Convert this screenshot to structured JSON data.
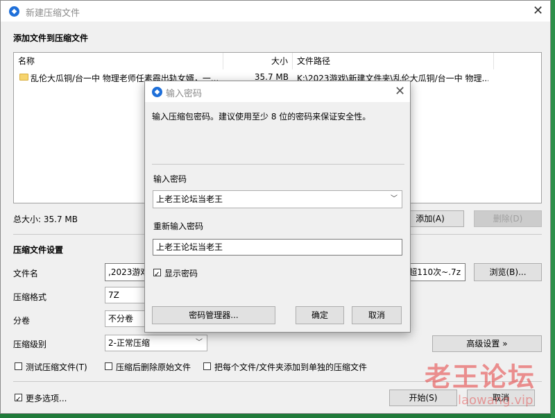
{
  "window": {
    "title": "新建压缩文件",
    "section_add": "添加文件到压缩文件",
    "columns": [
      "名称",
      "大小",
      "文件路径"
    ],
    "files": [
      {
        "name": "乱伦大瓜铜/台一中 物理老师任素霞出轨女婿，一...",
        "size": "35.7 MB",
        "path": "K:\\2023游戏\\新建文件夹\\乱伦大瓜铜/台一中 物理..."
      }
    ],
    "total_size": "总大小: 35.7 MB",
    "add_button": "添加(A)",
    "delete_button": "删除(D)",
    "settings_title": "压缩文件设置",
    "filename_label": "文件名",
    "filename_value": ",2023游戏\\",
    "filename_tail": "超110次~.7z",
    "browse_button": "浏览(B)...",
    "format_label": "压缩格式",
    "format_value": "7Z",
    "split_label": "分卷",
    "split_value": "不分卷",
    "level_label": "压缩级别",
    "level_value": "2-正常压缩",
    "advanced_button": "高级设置 »",
    "test_checkbox": "测试压缩文件(T)",
    "delete_after_checkbox": "压缩后删除原始文件",
    "separate_checkbox": "把每个文件/文件夹添加到单独的压缩文件",
    "more_options": "更多选项...",
    "start_button": "开始(S)",
    "cancel_button": "取消"
  },
  "dialog": {
    "title": "输入密码",
    "message": "输入压缩包密码。建议使用至少 8 位的密码来保证安全性。",
    "password_label": "输入密码",
    "password_value": "上老王论坛当老王",
    "reenter_label": "重新输入密码",
    "reenter_value": "上老王论坛当老王",
    "show_password": "显示密码",
    "manager_button": "密码管理器...",
    "ok_button": "确定",
    "cancel_button": "取消"
  },
  "watermark": {
    "text": "老王论坛",
    "url": "laowang.vip"
  },
  "colors": {
    "accent": "#1e6fd9",
    "window_bg": "#f0f0f0",
    "watermark": "#e63c3c"
  }
}
